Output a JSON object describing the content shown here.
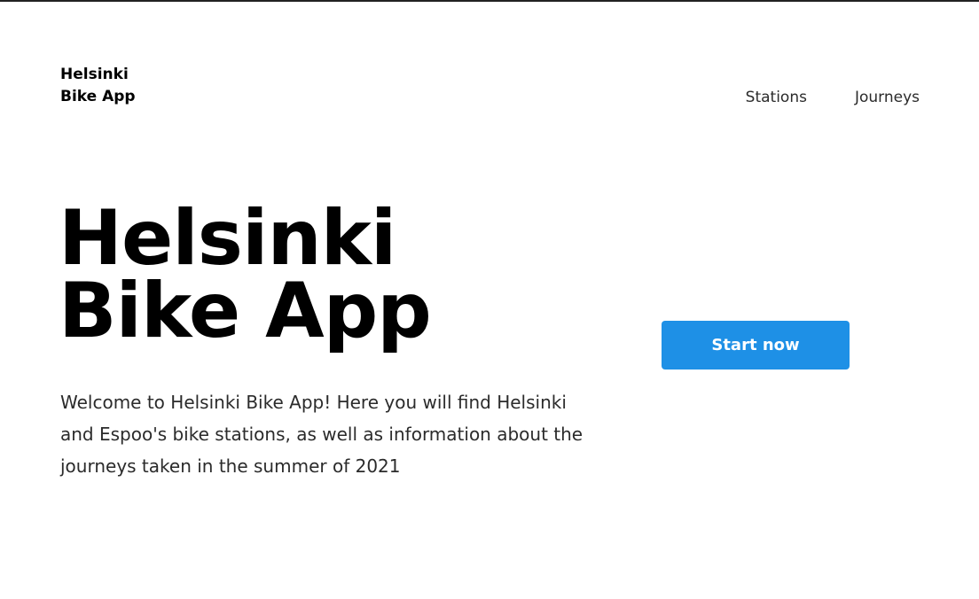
{
  "header": {
    "brand_line1": "Helsinki",
    "brand_line2": "Bike App",
    "nav": [
      {
        "label": "Stations"
      },
      {
        "label": "Journeys"
      }
    ]
  },
  "hero": {
    "title_line1": "Helsinki",
    "title_line2": "Bike App",
    "description": "Welcome to Helsinki Bike App! Here you will find Helsinki and Espoo's bike stations, as well as information about the journeys taken in the summer of 2021",
    "cta_label": "Start now"
  },
  "colors": {
    "accent": "#1e90e6",
    "text": "#000000",
    "body_text": "#2b2b2b",
    "background": "#ffffff"
  }
}
